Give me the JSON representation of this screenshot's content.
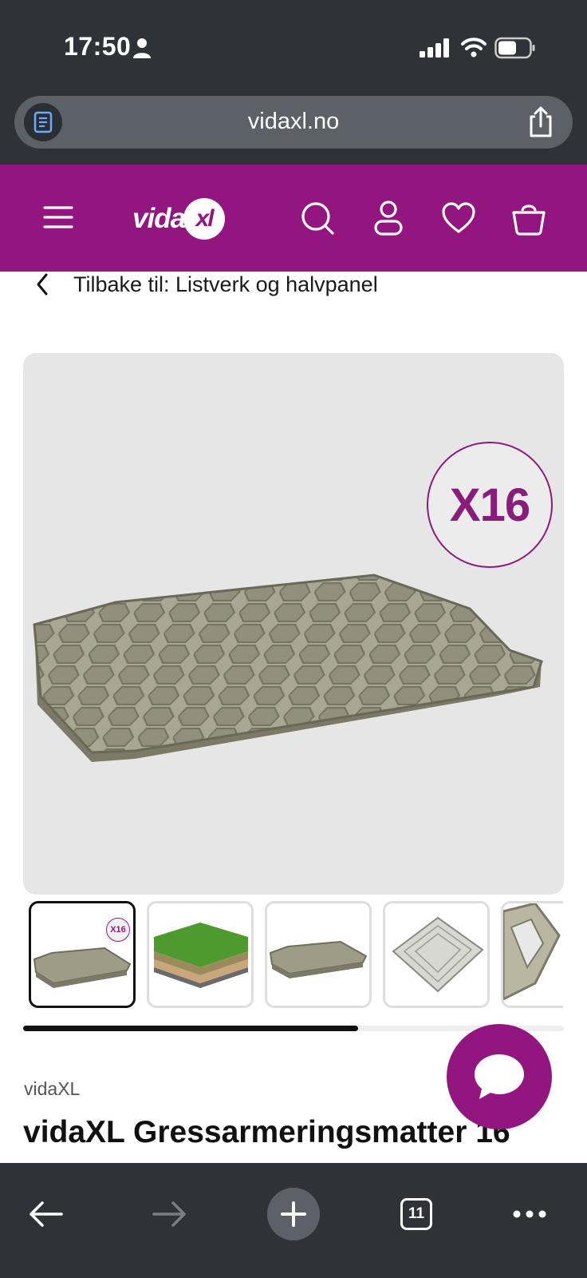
{
  "status_bar": {
    "time": "17:50",
    "icons": [
      "person-icon",
      "signal-icon",
      "wifi-icon",
      "battery-icon"
    ]
  },
  "browser": {
    "url": "vidaxl.no",
    "reader_icon": "reader-icon",
    "share_icon": "share-icon"
  },
  "header": {
    "logo_main": "vida",
    "logo_accent": "xl",
    "icons": [
      "menu-icon",
      "search-icon",
      "account-icon",
      "wishlist-icon",
      "cart-icon"
    ],
    "brand_color": "#93157f"
  },
  "breadcrumb": {
    "text": "Tilbake til: Listverk og halvpanel"
  },
  "gallery": {
    "badge_text": "X16",
    "thumbnails": [
      {
        "name": "thumb-mat-x16",
        "active": true,
        "badge": "X16"
      },
      {
        "name": "thumb-grass-layers",
        "active": false
      },
      {
        "name": "thumb-mat-plain",
        "active": false
      },
      {
        "name": "thumb-mat-grid",
        "active": false
      },
      {
        "name": "thumb-mat-closeup",
        "active": false
      }
    ],
    "scroll_progress": 0.62
  },
  "product": {
    "brand": "vidaXL",
    "title": "vidaXL Gressarmeringsmatter 16"
  },
  "chat": {
    "icon": "chat-bubble-icon"
  },
  "toolbar": {
    "tabs_count": "11",
    "icons": [
      "back-arrow-icon",
      "forward-arrow-icon",
      "plus-icon",
      "tabs-icon",
      "more-icon"
    ]
  }
}
